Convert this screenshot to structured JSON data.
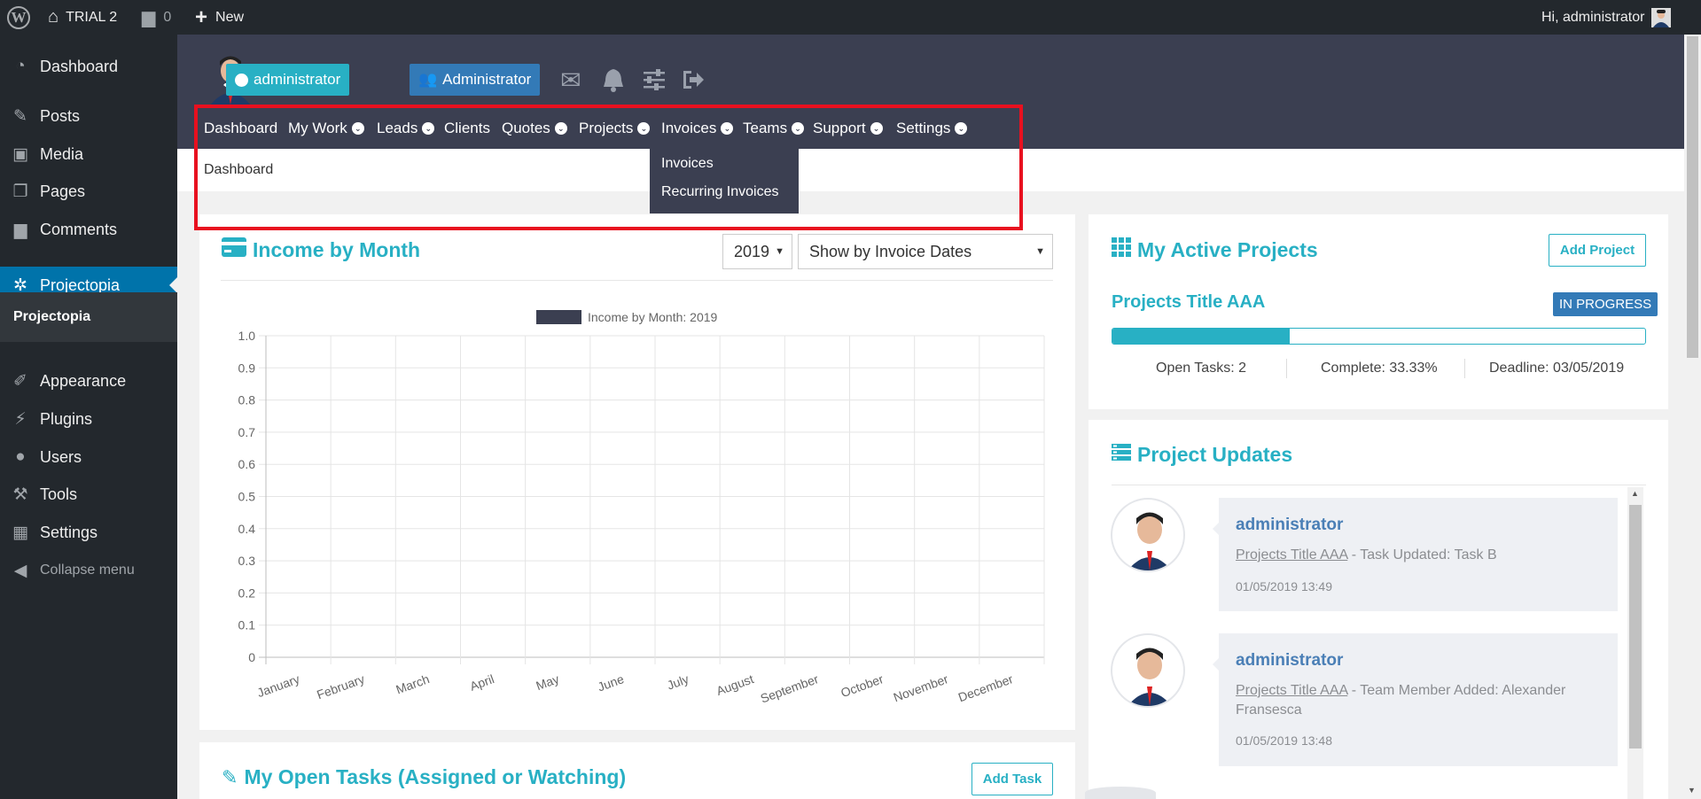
{
  "adminbar": {
    "site_name": "TRIAL 2",
    "comments_count": "0",
    "new_label": "New",
    "greeting": "Hi, administrator"
  },
  "wpmenu": {
    "items": [
      {
        "label": "Dashboard",
        "icon": "dashboard-icon"
      },
      {
        "label": "Posts",
        "icon": "pin-icon"
      },
      {
        "label": "Media",
        "icon": "media-icon"
      },
      {
        "label": "Pages",
        "icon": "pages-icon"
      },
      {
        "label": "Comments",
        "icon": "comment-icon"
      },
      {
        "label": "Projectopia",
        "icon": "palm-icon"
      },
      {
        "label": "Appearance",
        "icon": "brush-icon"
      },
      {
        "label": "Plugins",
        "icon": "plug-icon"
      },
      {
        "label": "Users",
        "icon": "user-icon"
      },
      {
        "label": "Tools",
        "icon": "wrench-icon"
      },
      {
        "label": "Settings",
        "icon": "settings-icon"
      },
      {
        "label": "Collapse menu",
        "icon": "collapse-icon"
      }
    ],
    "submenu_label": "Projectopia"
  },
  "header": {
    "user_badge": "administrator",
    "role_badge": "Administrator",
    "nav": [
      {
        "label": "Dashboard",
        "dropdown": false
      },
      {
        "label": "My Work",
        "dropdown": true
      },
      {
        "label": "Leads",
        "dropdown": true
      },
      {
        "label": "Clients",
        "dropdown": false
      },
      {
        "label": "Quotes",
        "dropdown": true
      },
      {
        "label": "Projects",
        "dropdown": true
      },
      {
        "label": "Invoices",
        "dropdown": true
      },
      {
        "label": "Teams",
        "dropdown": true
      },
      {
        "label": "Support",
        "dropdown": true
      },
      {
        "label": "Settings",
        "dropdown": true
      }
    ],
    "invoices_dropdown": [
      "Invoices",
      "Recurring Invoices"
    ]
  },
  "breadcrumb": "Dashboard",
  "income": {
    "title": "Income by Month",
    "year": "2019",
    "filter": "Show by Invoice Dates"
  },
  "chart_data": {
    "type": "bar",
    "legend": "Income by Month: 2019",
    "legend_color": "#3b3f51",
    "categories": [
      "January",
      "February",
      "March",
      "April",
      "May",
      "June",
      "July",
      "August",
      "September",
      "October",
      "November",
      "December"
    ],
    "series": [
      {
        "name": "Income by Month: 2019",
        "values": [
          0,
          0,
          0,
          0,
          0,
          0,
          0,
          0,
          0,
          0,
          0,
          0
        ]
      }
    ],
    "yticks": [
      "0",
      "0.1",
      "0.2",
      "0.3",
      "0.4",
      "0.5",
      "0.6",
      "0.7",
      "0.8",
      "0.9",
      "1.0"
    ],
    "ylim": [
      0,
      1.0
    ],
    "grid": true,
    "legend_position": "top"
  },
  "active_projects": {
    "title": "My Active Projects",
    "add_label": "Add Project",
    "project_title": "Projects Title AAA",
    "status": "IN PROGRESS",
    "progress": 0.3333,
    "open_tasks": "Open Tasks: 2",
    "complete": "Complete: 33.33%",
    "deadline": "Deadline: 03/05/2019"
  },
  "updates": {
    "title": "Project Updates",
    "items": [
      {
        "who": "administrator",
        "link": "Projects Title AAA",
        "text": " - Task Updated: Task B",
        "time": "01/05/2019 13:49"
      },
      {
        "who": "administrator",
        "link": "Projects Title AAA",
        "text": " - Team Member Added: Alexander Fransesca",
        "time": "01/05/2019 13:48"
      }
    ]
  },
  "open_tasks": {
    "title": "My Open Tasks (Assigned or Watching)",
    "add_label": "Add Task"
  },
  "colors": {
    "accent": "#28b0c4",
    "header_bg": "#3b3f51",
    "wp_dark": "#23282d",
    "wp_blue": "#0073aa",
    "highlight": "#e8101f"
  }
}
